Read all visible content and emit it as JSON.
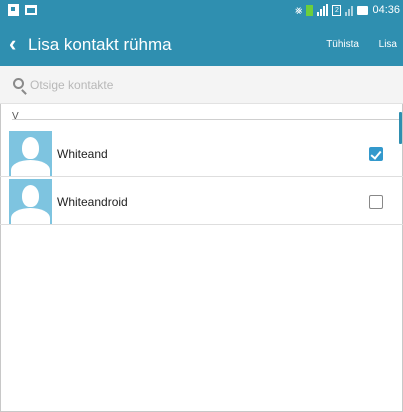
{
  "status_bar": {
    "time": "04:36",
    "icons": [
      "screenshot-icon",
      "notification-icon",
      "mute-icon",
      "battery-saver-icon",
      "signal-icon",
      "sim-icon",
      "signal-icon-2",
      "battery-icon"
    ],
    "sim_label": "2"
  },
  "header": {
    "title": "Lisa kontakt rühma",
    "cancel_label": "Tühista",
    "add_label": "Lisa",
    "color": "#2f8fb0"
  },
  "search": {
    "placeholder": "Otsige kontakte",
    "value": ""
  },
  "section": {
    "letter": "V"
  },
  "contacts": [
    {
      "name": "Whiteand",
      "checked": true
    },
    {
      "name": "Whiteandroid",
      "checked": false
    }
  ],
  "accent_color": "#3399cc"
}
